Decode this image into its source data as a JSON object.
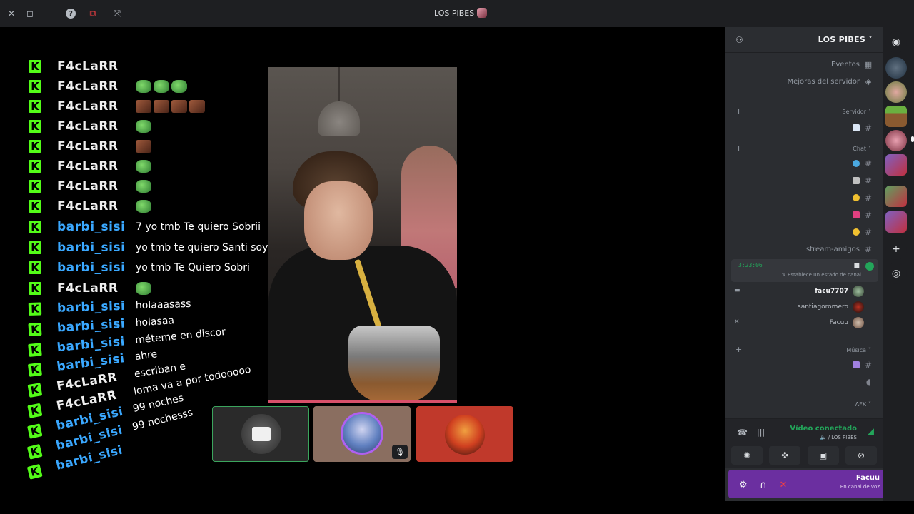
{
  "window": {
    "title": "LOS PIBES",
    "controls": [
      "✕",
      "◻",
      "–"
    ],
    "tools": [
      "?",
      "⧉",
      "⤧"
    ]
  },
  "chat": [
    {
      "user": "F4cLaRR",
      "color": "f4",
      "msg": "",
      "emotes": []
    },
    {
      "user": "F4cLaRR",
      "color": "f4",
      "msg": "",
      "emotes": [
        "pepe",
        "pepe",
        "pepe"
      ]
    },
    {
      "user": "F4cLaRR",
      "color": "f4",
      "msg": "",
      "emotes": [
        "face",
        "face",
        "face",
        "face"
      ]
    },
    {
      "user": "F4cLaRR",
      "color": "f4",
      "msg": "",
      "emotes": [
        "pepe"
      ]
    },
    {
      "user": "F4cLaRR",
      "color": "f4",
      "msg": "",
      "emotes": [
        "face"
      ]
    },
    {
      "user": "F4cLaRR",
      "color": "f4",
      "msg": "",
      "emotes": [
        "pepe"
      ]
    },
    {
      "user": "F4cLaRR",
      "color": "f4",
      "msg": "",
      "emotes": [
        "pepe"
      ]
    },
    {
      "user": "F4cLaRR",
      "color": "f4",
      "msg": "",
      "emotes": [
        "pepe"
      ]
    },
    {
      "user": "barbi_sisi",
      "color": "barbi",
      "msg": "7 yo tmb Te quiero Sobrii",
      "emotes": []
    },
    {
      "user": "barbi_sisi",
      "color": "barbi",
      "msg": "yo tmb te quiero Santi soy pipi",
      "emotes": []
    },
    {
      "user": "barbi_sisi",
      "color": "barbi",
      "msg": "yo tmb Te Quiero Sobri",
      "emotes": []
    },
    {
      "user": "F4cLaRR",
      "color": "f4",
      "msg": "",
      "emotes": [
        "pepe"
      ]
    },
    {
      "user": "barbi_sisi",
      "color": "barbi",
      "msg": "holaaasass",
      "emotes": []
    },
    {
      "user": "barbi_sisi",
      "color": "barbi",
      "msg": "holasaa",
      "emotes": []
    },
    {
      "user": "barbi_sisi",
      "color": "barbi",
      "msg": "méteme en discor",
      "emotes": []
    },
    {
      "user": "barbi_sisi",
      "color": "barbi",
      "msg": "ahre",
      "emotes": []
    },
    {
      "user": "F4cLaRR",
      "color": "f4",
      "msg": "escriban e",
      "emotes": []
    },
    {
      "user": "F4cLaRR",
      "color": "f4",
      "msg": "loma va a por todooooo",
      "emotes": []
    },
    {
      "user": "barbi_sisi",
      "color": "barbi",
      "msg": "99 noches",
      "emotes": []
    },
    {
      "user": "barbi_sisi",
      "color": "barbi",
      "msg": "99 nochesss",
      "emotes": []
    },
    {
      "user": "barbi_sisi",
      "color": "barbi",
      "msg": "",
      "emotes": []
    }
  ],
  "server": {
    "name": "LOS PIBES",
    "events": "Eventos",
    "boosts": "Mejoras del servidor",
    "categories": {
      "servidor": "Servidor",
      "chat": "Chat",
      "musica": "Música",
      "afk": "AFK"
    },
    "stream_channel": "stream-amigos",
    "voice": {
      "timer": "3:23:06",
      "status_hint": "Establece un estado de canal"
    },
    "voice_users": [
      {
        "name": "facu7707",
        "bold": true
      },
      {
        "name": "santiagoromero",
        "bold": false
      },
      {
        "name": "Facuu",
        "bold": false
      }
    ]
  },
  "rtc": {
    "status": "Vídeo conectado",
    "channel": "🔈 / LOS PIBES"
  },
  "user": {
    "name": "Facuu",
    "status": "En canal de voz"
  },
  "colors": {
    "kick_green": "#53fc18",
    "barbi_blue": "#3aa8ff",
    "connected_green": "#23a55a",
    "user_panel": "#6b2fa0"
  }
}
